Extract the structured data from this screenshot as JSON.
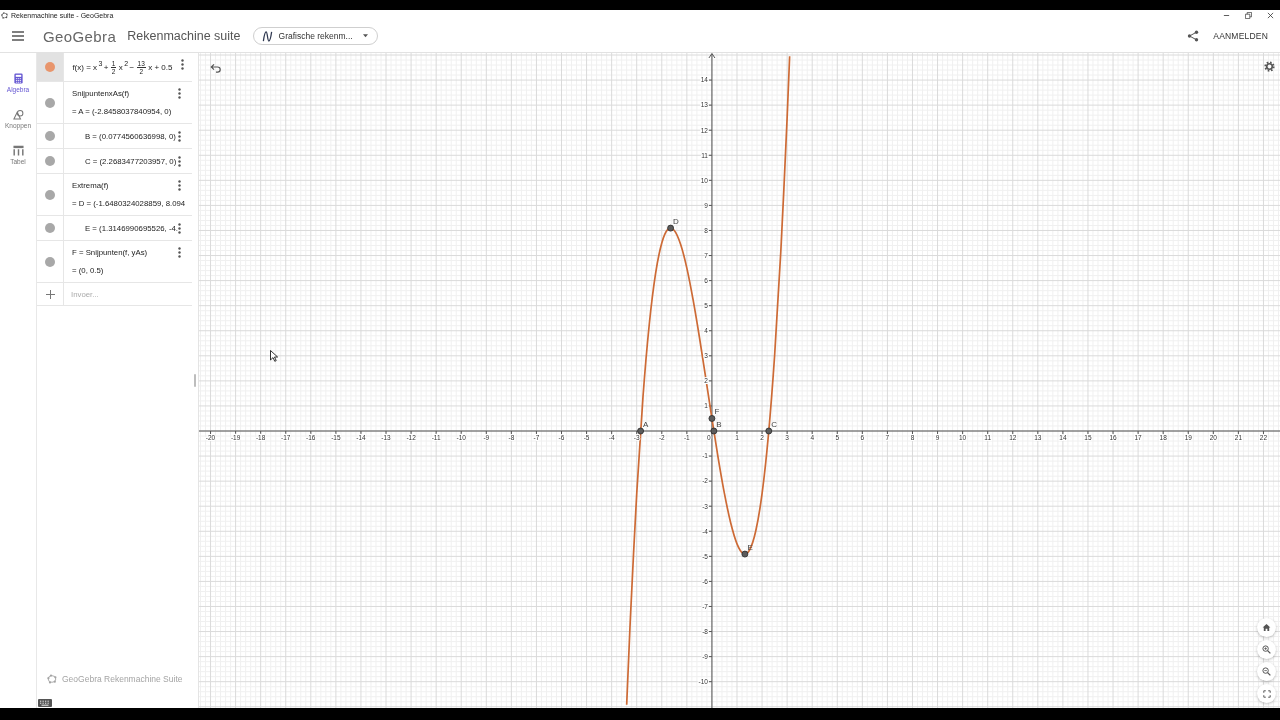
{
  "window": {
    "title": "Rekenmachine suite - GeoGebra"
  },
  "header": {
    "logo": "GeoGebra",
    "app_title": "Rekenmachine suite",
    "app_switcher": "Grafische rekenm...",
    "sign_in": "AANMELDEN"
  },
  "sidebar": {
    "items": [
      {
        "label": "Algebra",
        "selected": true
      },
      {
        "label": "Knoppen",
        "selected": false
      },
      {
        "label": "Tabel",
        "selected": false
      }
    ]
  },
  "algebra": {
    "rows": [
      {
        "kind": "formula",
        "selected": true,
        "color": "#e8956c",
        "parts": [
          {
            "kind": "text",
            "text": "f(x) = x"
          },
          {
            "kind": "sup",
            "text": "3"
          },
          {
            "kind": "text",
            "text": "+"
          },
          {
            "kind": "frac",
            "num": "1",
            "den": "2"
          },
          {
            "kind": "text",
            "text": "x"
          },
          {
            "kind": "sup",
            "text": "2"
          },
          {
            "kind": "text",
            "text": "−"
          },
          {
            "kind": "frac",
            "num": "13",
            "den": "2"
          },
          {
            "kind": "text",
            "text": "x + 0.5"
          }
        ]
      },
      {
        "kind": "command",
        "selected": false,
        "color": "#a8a8a8",
        "definition": "SnijpuntenxAs(f)",
        "value": "= A = (-2.8458037840954, 0)"
      },
      {
        "kind": "value",
        "selected": false,
        "color": "#a8a8a8",
        "value": "B = (0.0774560636998, 0)"
      },
      {
        "kind": "value",
        "selected": false,
        "color": "#a8a8a8",
        "value": "C = (2.2683477203957, 0)"
      },
      {
        "kind": "command",
        "selected": false,
        "color": "#a8a8a8",
        "definition": "Extrema(f)",
        "value": "= D = (-1.6480324028859, 8.094"
      },
      {
        "kind": "value",
        "selected": false,
        "color": "#a8a8a8",
        "value": "E = (1.3146990695526, -4."
      },
      {
        "kind": "command",
        "selected": false,
        "color": "#a8a8a8",
        "definition": "F = Snijpunten(f, yAs)",
        "value": "= (0, 0.5)"
      }
    ],
    "input": {
      "placeholder": "Invoer..."
    },
    "footer": "GeoGebra Rekenmachine Suite"
  },
  "graphics": {
    "chart_data": {
      "type": "line",
      "grid": true,
      "x": [
        -3.4,
        -3.25,
        -3,
        -2.75,
        -2.5,
        -2.25,
        -2,
        -1.75,
        -1.5,
        -1.25,
        -1,
        -0.75,
        -0.5,
        -0.25,
        0,
        0.25,
        0.5,
        0.75,
        1,
        1.25,
        1.5,
        1.75,
        2,
        2.25,
        2.5,
        2.75,
        3,
        3.1
      ],
      "series": [
        {
          "color": "#cd6a35",
          "values": [
            -10.92,
            -7.42,
            -2.5,
            1.36,
            4.25,
            6.27,
            7.5,
            8.05,
            8,
            7.45,
            6.5,
            5.23,
            3.75,
            2.14,
            0.5,
            -1.08,
            -2.5,
            -3.67,
            -4.5,
            -4.89,
            -4.75,
            -3.98,
            -2.5,
            -0.2,
            3,
            7.2,
            12.5,
            14.95
          ]
        }
      ],
      "xlim": [
        -20.46,
        22.66
      ],
      "ylim": [
        -11.05,
        15.08
      ],
      "xticks": [
        -20,
        -19,
        -18,
        -17,
        -16,
        -15,
        -14,
        -13,
        -12,
        -11,
        -10,
        -9,
        -8,
        -7,
        -6,
        -5,
        -4,
        -3,
        -2,
        -1,
        0,
        1,
        2,
        3,
        4,
        5,
        6,
        7,
        8,
        9,
        10,
        11,
        12,
        13,
        14,
        15,
        16,
        17,
        18,
        19,
        20,
        21,
        22
      ],
      "yticks": [
        -10,
        -9,
        -8,
        -7,
        -6,
        -5,
        -4,
        -3,
        -2,
        -1,
        1,
        2,
        3,
        4,
        5,
        6,
        7,
        8,
        9,
        10,
        11,
        12,
        13,
        14
      ],
      "annotations": [
        {
          "text": "A",
          "x": -2.8458,
          "y": 0
        },
        {
          "text": "B",
          "x": 0.0775,
          "y": 0
        },
        {
          "text": "C",
          "x": 2.2683,
          "y": 0
        },
        {
          "text": "D",
          "x": -1.648,
          "y": 8.094
        },
        {
          "text": "E",
          "x": 1.3147,
          "y": -4.909
        },
        {
          "text": "F",
          "x": 0,
          "y": 0.5
        }
      ]
    }
  }
}
